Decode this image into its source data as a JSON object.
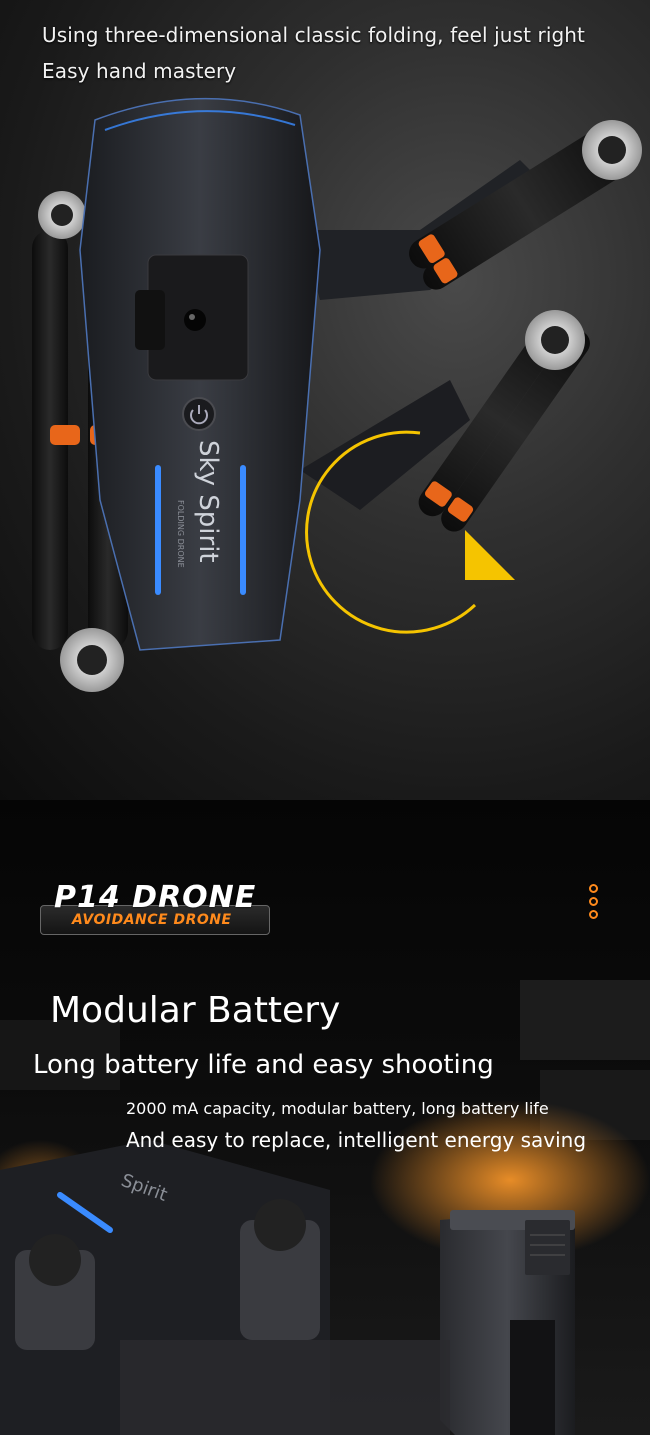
{
  "intro": {
    "line1": "Using three-dimensional classic folding, feel just right",
    "line2": "Easy hand mastery"
  },
  "drone_body": {
    "brand_text": "Sky Spirit",
    "brand_subtext": "FOLDING DRONE"
  },
  "badge": {
    "title": "P14 DRONE",
    "subtitle": "AVOIDANCE DRONE"
  },
  "battery": {
    "title": "Modular Battery",
    "subtitle": "Long battery life and easy shooting",
    "detail1": "2000 mA capacity, modular battery, long battery life",
    "detail2": "And easy to replace, intelligent energy saving"
  },
  "colors": {
    "accent_orange": "#ff8a1c",
    "arrow_yellow": "#f5c400",
    "led_blue": "#3a8bff"
  },
  "icons": [
    "power-icon",
    "rotate-arrow-icon",
    "more-dots-icon"
  ]
}
